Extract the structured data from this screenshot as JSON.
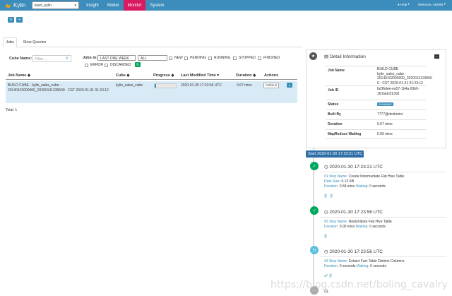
{
  "nav": {
    "brand": "Kylin",
    "project": "learn_kylin",
    "tabs": [
      "Insight",
      "Model",
      "Monitor",
      "System"
    ],
    "active_tab": "Monitor",
    "help": "Help",
    "welcome": "Welcome, ADMIN",
    "colors": {
      "bar": "#3c8dbc",
      "active": "#d81b60"
    }
  },
  "tabs": {
    "jobs": "Jobs",
    "slow_queries": "Slow Queries"
  },
  "filters": {
    "cube_name_label": "Cube Name:",
    "cube_name_placeholder": "Filter ...",
    "jobs_in_label": "Jobs in:",
    "time_range": "LAST ONE WEEK",
    "status_select": "ALL",
    "checkboxes": [
      "NEW",
      "PENDING",
      "RUNNING",
      "STOPPED",
      "FINISHED",
      "ERROR",
      "DISCARDED"
    ]
  },
  "table": {
    "headers": {
      "job_name": "Job Name ◆",
      "cube": "Cube ◆",
      "progress": "Progress ◆",
      "last_modified": "Last Modified Time ▾",
      "duration": "Duration ◆",
      "actions": "Actions"
    },
    "row": {
      "job_name": "BUILD CUBE - kylin_sales_cube - 20140102000000_20200131235500 - CST 2020-01-31 01:23:12",
      "cube": "kylin_sales_cube",
      "progress_pct": 5,
      "last_modified": "2020-01-30 17:23:56 UTC",
      "duration": "0.67 mins",
      "action": "Action ▾"
    },
    "total": "Total: 1"
  },
  "detail": {
    "title": "Detail Information",
    "rows": [
      {
        "key": "Job Name",
        "value": "BUILD CUBE - kylin_sales_cube - 20140102000000_2020013123550 0 - CST 2020-01-31 01:23:12"
      },
      {
        "key": "Job ID",
        "value": "fa2fbdee-ea57-1b4a-93b0-1fc0adc013d2"
      },
      {
        "key": "Status",
        "value": "RUNNING"
      },
      {
        "key": "Built By",
        "value": "7777@deskmini"
      },
      {
        "key": "Duration",
        "value": "0.67 mins"
      },
      {
        "key": "MapReduce Waiting",
        "value": "0.00 mins"
      }
    ]
  },
  "timeline": {
    "start_label": "Start   2020-01-30 17:23:21 UTC",
    "steps": [
      {
        "time": "2020-01-30 17:23:21 UTC",
        "step": "#1 Step Name:",
        "name": "Create Intermediate Flat Hive Table",
        "data_size_label": "Data Size:",
        "data_size": "0.13 KB",
        "duration": "Duration:",
        "duration_val": "0.58 mins",
        "waiting": "Waiting:",
        "waiting_val": "0 seconds"
      },
      {
        "time": "2020-01-30 17:23:56 UTC",
        "step": "#2 Step Name:",
        "name": "Redistribute Flat Hive Table",
        "duration": "Duration:",
        "duration_val": "0.00 mins",
        "waiting": "Waiting:",
        "waiting_val": "0 seconds"
      },
      {
        "time": "2020-01-30 17:23:56 UTC",
        "step": "#3 Step Name:",
        "name": "Extract Fact Table Distinct Columns",
        "duration": "Duration:",
        "duration_val": "0 seconds",
        "waiting": "Waiting:",
        "waiting_val": "0 seconds"
      }
    ]
  },
  "watermark": "https://blog.csdn.net/boling_cavalry"
}
